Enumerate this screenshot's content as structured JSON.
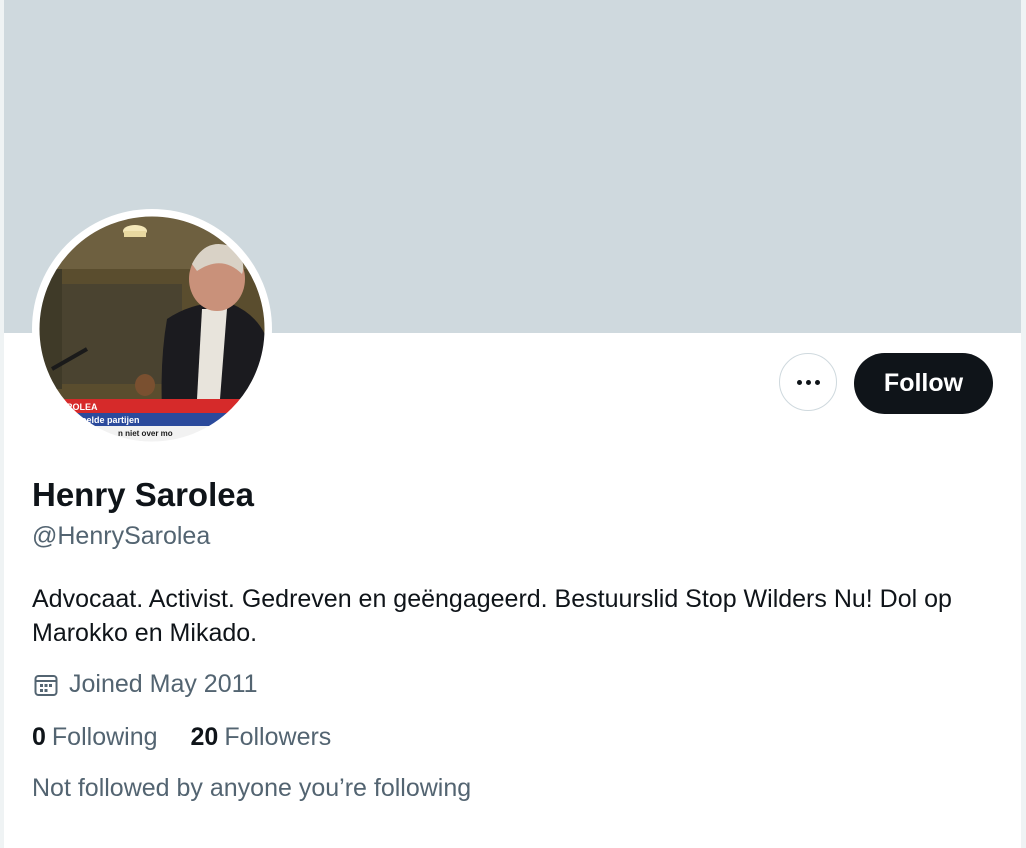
{
  "profile": {
    "display_name": "Henry Sarolea",
    "handle": "@HenrySarolea",
    "bio": "Advocaat. Activist. Gedreven en geëngageerd. Bestuurslid Stop Wilders Nu! Dol op Marokko en Mikado.",
    "joined": "Joined May 2011",
    "following_count": "0",
    "following_label": "Following",
    "followers_count": "20",
    "followers_label": "Followers",
    "followed_by_note": "Not followed by anyone you’re following"
  },
  "actions": {
    "follow_label": "Follow",
    "more_icon": "more-horizontal-icon"
  },
  "avatar": {
    "caption_top": "ROLEA",
    "caption_mid": "deelde partijen",
    "caption_bottom": "n niet over mo"
  },
  "colors": {
    "banner": "#cfd9de",
    "primary_text": "#0f1419",
    "secondary_text": "#536471",
    "follow_button_bg": "#0f1419",
    "follow_button_text": "#ffffff",
    "border": "#cfd9de"
  },
  "icons": {
    "calendar": "calendar-icon"
  }
}
